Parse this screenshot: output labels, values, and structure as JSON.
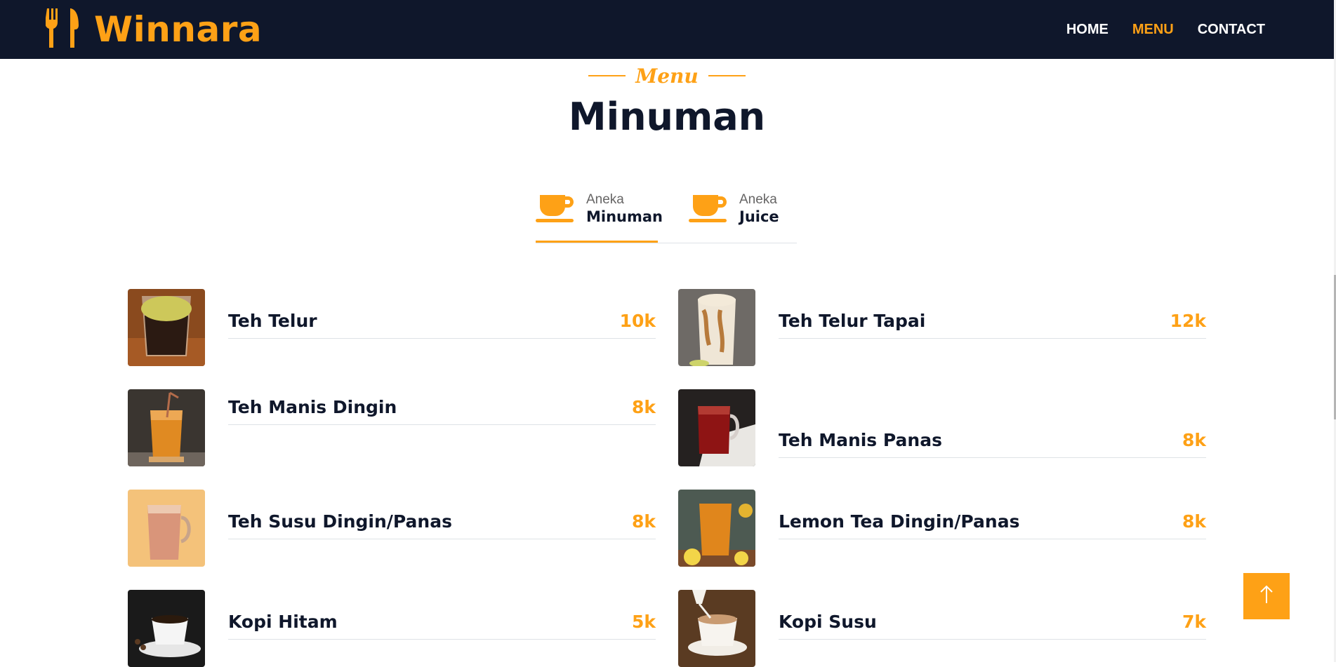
{
  "navbar": {
    "brand": "Winnara",
    "links": [
      {
        "label": "HOME",
        "active": false
      },
      {
        "label": "MENU",
        "active": true
      },
      {
        "label": "CONTACT",
        "active": false
      }
    ]
  },
  "section": {
    "subtitle": "Menu",
    "title": "Minuman"
  },
  "tabs": [
    {
      "small": "Aneka",
      "big": "Minuman",
      "icon": "coffee-cup-icon",
      "active": true
    },
    {
      "small": "Aneka",
      "big": "Juice",
      "icon": "coffee-cup-icon",
      "active": false
    }
  ],
  "menu": {
    "left": [
      {
        "name": "Teh Telur",
        "price": "10k"
      },
      {
        "name": "Teh Manis Dingin",
        "price": "8k"
      },
      {
        "name": "Teh Susu Dingin/Panas",
        "price": "8k"
      },
      {
        "name": "Kopi Hitam",
        "price": "5k"
      }
    ],
    "right": [
      {
        "name": "Teh Telur Tapai",
        "price": "12k"
      },
      {
        "name": "Teh Manis Panas",
        "price": "8k"
      },
      {
        "name": "Lemon Tea Dingin/Panas",
        "price": "8k"
      },
      {
        "name": "Kopi Susu",
        "price": "7k"
      }
    ]
  },
  "colors": {
    "primary": "#fea116",
    "dark": "#0f172b"
  }
}
